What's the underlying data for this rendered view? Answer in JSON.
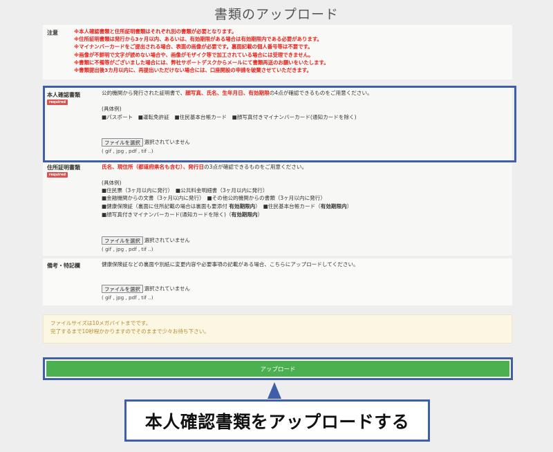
{
  "page": {
    "title": "書類のアップロード"
  },
  "notes": {
    "label": "注意",
    "items": [
      "※本人確認書類と住所証明書類はそれぞれ別の書類が必要となります。",
      "※住所証明書類は発行から3ヶ月以内、あるいは、有効期限がある場合は有効期限内である必要があります。",
      "※マイナンバーカードをご提出される場合、表面の画像が必要です。裏面記載の個人番号等は不要です。",
      "※画像が不鮮明で文字が読めない場合や、画像がモザイク等で加工されている場合には受理できません。",
      "※書類に不備等がございました場合には、弊社サポートデスクからメールにて書類再送のお願いをいたします。",
      "※書類提出後3カ月以内に、再提出いただけない場合には、口座開設の申請を破棄させていただきます。"
    ]
  },
  "identity": {
    "label": "本人確認書類",
    "badge": "required",
    "desc_prefix": "公的機関から発行された証明書で、",
    "desc_red": "顔写真、氏名、生年月日、有効期限",
    "desc_suffix": "の4点が確認できるものをご用意ください。",
    "examples_heading": "(具体例)",
    "examples": "■パスポート　■運転免許証　■住民基本台帳カード　■顔写真付きマイナンバーカード(通知カードを除く)",
    "file_button": "ファイルを選択",
    "file_status": "選択されていません",
    "file_types": "( gif , jpg , pdf , tif ..)"
  },
  "address": {
    "label": "住所証明書類",
    "badge": "required",
    "desc_red": "氏名、現住所（都道府県名も含む）、発行日",
    "desc_suffix": "の3点が確認できるものをご用意ください。",
    "examples_heading": "(具体例)",
    "line1": "■住民票（3ヶ月以内に発行）　■公共料金明細書（3ヶ月以内に発行）",
    "line2": "■金融機関からの文書（3ヶ月以内に発行）　■その他公的機関からの書類（3ヶ月以内に発行）",
    "line3_a": "■健康保険証（裏面に住所記載の場合は裏面も要添付",
    "line3_b": "有効期限内",
    "line3_c": "）　■住民基本台帳カード（",
    "line3_d": "有効期限内",
    "line3_e": "）",
    "line4_a": "■顔写真付きマイナンバーカード(通知カードを除く)（",
    "line4_b": "有効期限内",
    "line4_c": "）",
    "file_button": "ファイルを選択",
    "file_status": "選択されていません",
    "file_types": "( gif , jpg , pdf , tif ..)"
  },
  "remarks": {
    "label": "備考・特記欄",
    "desc": "健康保険証などの裏面や別紙に変更内容や必要事項の記載がある場合、こちらにアップロードしてください。",
    "file_button": "ファイルを選択",
    "file_status": "選択されていません",
    "file_types": "( gif , jpg , pdf , tif ..)"
  },
  "info": {
    "line1": "ファイルサイズは10メガバイトまでです。",
    "line2": "完了するまで10秒程かかりますのでそのままで少々お待ち下さい。"
  },
  "upload": {
    "label": "アップロード"
  },
  "callout": {
    "text": "本人確認書類をアップロードする"
  },
  "colors": {
    "highlight": "#3e5ea8",
    "required_badge": "#d9534f",
    "upload_button": "#4caf50",
    "warning_text": "#e8211a"
  }
}
